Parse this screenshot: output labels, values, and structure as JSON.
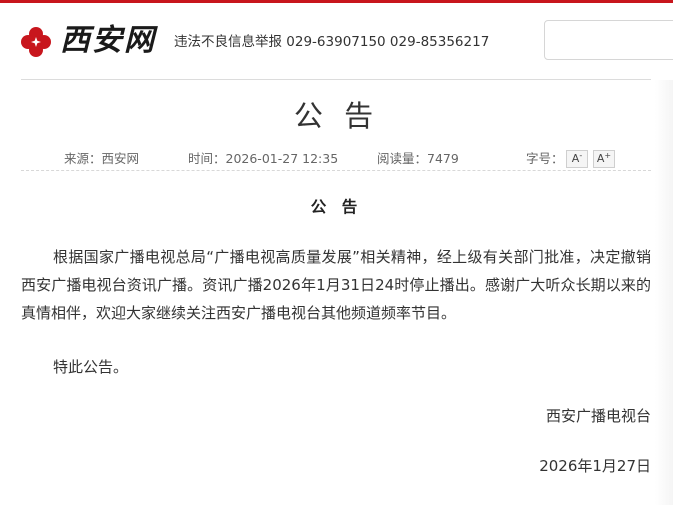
{
  "header": {
    "logo_text": "西安网",
    "hotline": "违法不良信息举报 029-63907150 029-85356217",
    "search_placeholder": ""
  },
  "article": {
    "title": "公 告",
    "meta": {
      "source": "来源：西安网",
      "time": "时间：2026-01-27 12:35",
      "views": "阅读量：7479",
      "font_size_label": "字号：",
      "font_decrease_label": "A",
      "font_decrease_mark": "-",
      "font_increase_label": "A",
      "font_increase_mark": "+"
    },
    "subtitle": "公 告",
    "body": "根据国家广播电视总局“广播电视高质量发展”相关精神，经上级有关部门批准，决定撤销西安广播电视台资讯广播。资讯广播2026年1月31日24时停止播出。感谢广大听众长期以来的真情相伴，欢迎大家继续关注西安广播电视台其他频道频率节目。",
    "closing": "特此公告。",
    "signature": "西安广播电视台",
    "date": "2026年1月27日"
  },
  "colors": {
    "brand_red": "#c8161d",
    "text": "#333333",
    "meta_text": "#666666"
  }
}
